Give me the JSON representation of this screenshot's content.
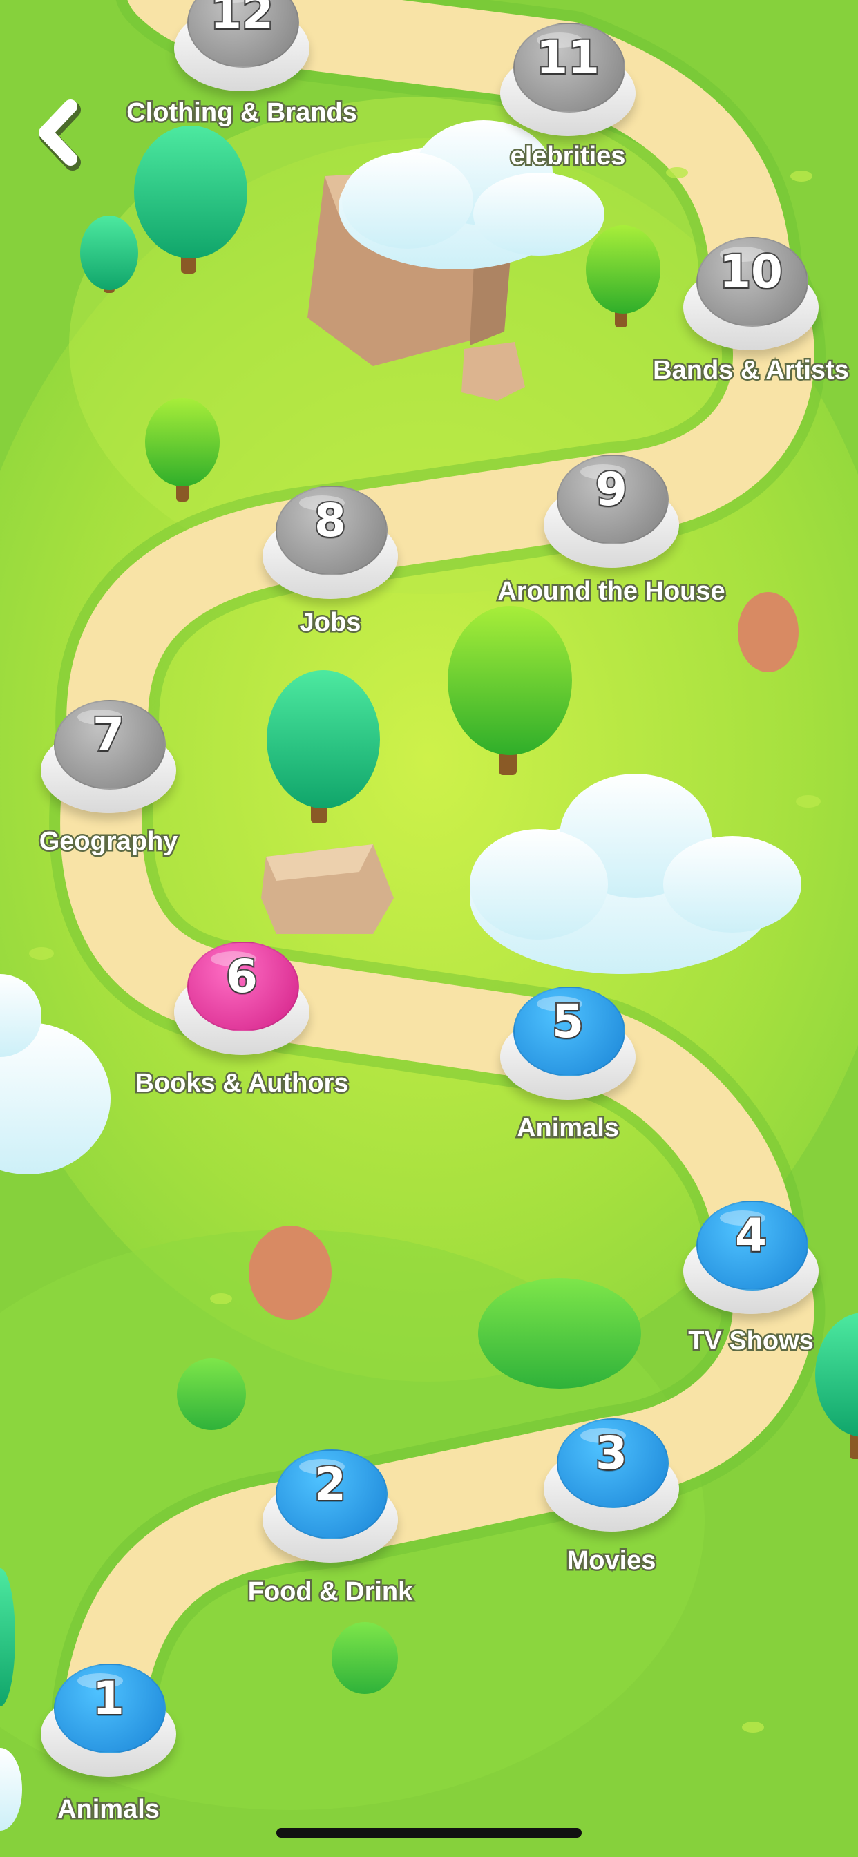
{
  "app": {
    "screen": "level-map",
    "colors": {
      "grass": "#8ed43a",
      "grass_light": "#d8f54a",
      "path": "#f8e3a6",
      "level_done": "#2f9de6",
      "level_current": "#e8339a",
      "level_locked": "#9a9a9a",
      "label_outline": "#5d6a44"
    }
  },
  "navigation": {
    "back_icon": "chevron-left-icon"
  },
  "levels": [
    {
      "number": "1",
      "label": "Animals",
      "state": "completed"
    },
    {
      "number": "2",
      "label": "Food & Drink",
      "state": "completed"
    },
    {
      "number": "3",
      "label": "Movies",
      "state": "completed"
    },
    {
      "number": "4",
      "label": "TV Shows",
      "state": "completed"
    },
    {
      "number": "5",
      "label": "Animals",
      "state": "completed"
    },
    {
      "number": "6",
      "label": "Books & Authors",
      "state": "current"
    },
    {
      "number": "7",
      "label": "Geography",
      "state": "locked"
    },
    {
      "number": "8",
      "label": "Jobs",
      "state": "locked"
    },
    {
      "number": "9",
      "label": "Around the House",
      "state": "locked"
    },
    {
      "number": "10",
      "label": "Bands & Artists",
      "state": "locked"
    },
    {
      "number": "11",
      "label": "elebrities",
      "state": "locked"
    },
    {
      "number": "12",
      "label": "Clothing & Brands",
      "state": "locked"
    }
  ]
}
